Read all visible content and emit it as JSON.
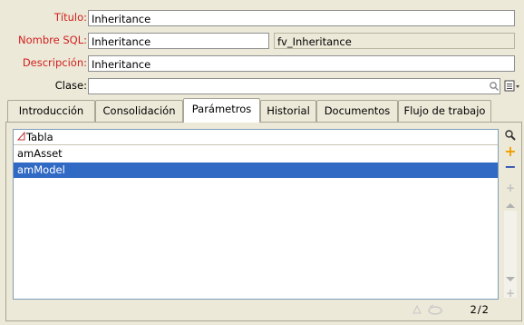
{
  "form": {
    "titulo_label": "Título:",
    "titulo_value": "Inheritance",
    "sql_label": "Nombre SQL:",
    "sql_value": "Inheritance",
    "sql_table": "fv_Inheritance",
    "desc_label": "Descripción:",
    "desc_value": "Inheritance",
    "clase_label": "Clase:",
    "clase_value": ""
  },
  "tabs": [
    {
      "label": "Introducción"
    },
    {
      "label": "Consolidación"
    },
    {
      "label": "Parámetros"
    },
    {
      "label": "Historial"
    },
    {
      "label": "Documentos"
    },
    {
      "label": "Flujo de trabajo"
    }
  ],
  "grid": {
    "column": "Tabla",
    "rows": [
      "amAsset",
      "amModel"
    ],
    "selected_index": 1
  },
  "footer": {
    "count": "2/2"
  },
  "colors": {
    "required_label": "#d22020",
    "selection": "#316ac5",
    "add": "#f0a000",
    "remove": "#3050b0"
  }
}
